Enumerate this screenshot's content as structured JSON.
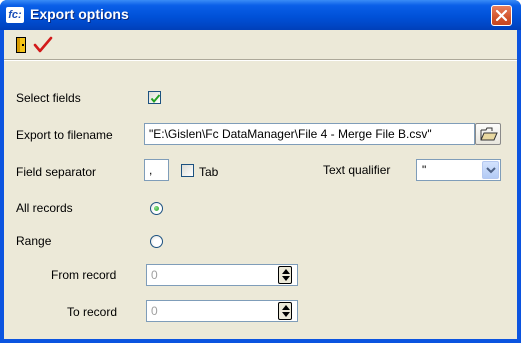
{
  "window": {
    "title": "Export options",
    "app_icon_text": "fc:"
  },
  "toolbar": {
    "exit_icon": "exit-door-icon",
    "ok_icon": "checkmark-icon"
  },
  "form": {
    "select_fields_label": "Select fields",
    "select_fields_checked": true,
    "export_filename_label": "Export to filename",
    "export_filename_value": "\"E:\\Gislen\\Fc DataManager\\File 4 - Merge File B.csv\"",
    "field_separator_label": "Field separator",
    "field_separator_value": ",",
    "tab_label": "Tab",
    "tab_checked": false,
    "text_qualifier_label": "Text qualifier",
    "text_qualifier_value": "\"",
    "all_records_label": "All records",
    "all_records_selected": true,
    "range_label": "Range",
    "range_selected": false,
    "from_record_label": "From record",
    "from_record_value": "0",
    "to_record_label": "To record",
    "to_record_value": "0"
  },
  "colors": {
    "titlebar": "#0051d8",
    "dialog_bg": "#ece9d8",
    "close_button": "#d2542b",
    "checkmark": "#21a121"
  }
}
